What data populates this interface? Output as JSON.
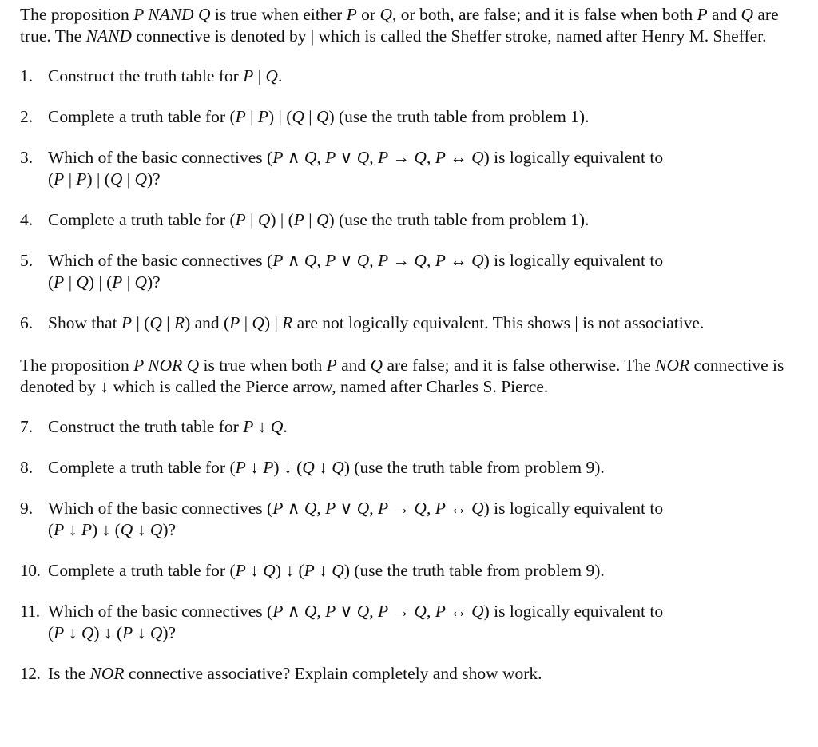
{
  "intro_nand": [
    {
      "t": "The proposition ",
      "i": false
    },
    {
      "t": "P NAND Q",
      "i": true
    },
    {
      "t": " is true when either ",
      "i": false
    },
    {
      "t": "P",
      "i": true
    },
    {
      "t": " or ",
      "i": false
    },
    {
      "t": "Q",
      "i": true
    },
    {
      "t": ", or both, are false; and it is false when both ",
      "i": false
    },
    {
      "t": "P",
      "i": true
    },
    {
      "t": " and ",
      "i": false
    },
    {
      "t": "Q",
      "i": true
    },
    {
      "t": " are true. The ",
      "i": false
    },
    {
      "t": "NAND",
      "i": true
    },
    {
      "t": " connective is denoted by | which is called the Sheffer stroke, named after Henry M. Sheffer.",
      "i": false
    }
  ],
  "problems_nand": [
    {
      "num": "1.",
      "parts": [
        {
          "t": "Construct the truth table for ",
          "i": false
        },
        {
          "t": "P",
          "i": true
        },
        {
          "t": " | ",
          "i": false
        },
        {
          "t": "Q",
          "i": true
        },
        {
          "t": ".",
          "i": false
        }
      ]
    },
    {
      "num": "2.",
      "parts": [
        {
          "t": "Complete a truth table for (",
          "i": false
        },
        {
          "t": "P",
          "i": true
        },
        {
          "t": " | ",
          "i": false
        },
        {
          "t": "P",
          "i": true
        },
        {
          "t": ") | (",
          "i": false
        },
        {
          "t": "Q",
          "i": true
        },
        {
          "t": " | ",
          "i": false
        },
        {
          "t": "Q",
          "i": true
        },
        {
          "t": ") (use the truth table from problem 1).",
          "i": false
        }
      ]
    },
    {
      "num": "3.",
      "parts": [
        {
          "t": "Which of the basic connectives (",
          "i": false
        },
        {
          "t": "P",
          "i": true
        },
        {
          "t": " ∧ ",
          "i": false
        },
        {
          "t": "Q",
          "i": true
        },
        {
          "t": ", ",
          "i": false
        },
        {
          "t": "P",
          "i": true
        },
        {
          "t": " ∨ ",
          "i": false
        },
        {
          "t": "Q",
          "i": true
        },
        {
          "t": ", ",
          "i": false
        },
        {
          "t": "P",
          "i": true
        },
        {
          "t": " → ",
          "i": false
        },
        {
          "t": "Q",
          "i": true
        },
        {
          "t": ", ",
          "i": false
        },
        {
          "t": "P",
          "i": true
        },
        {
          "t": " ↔ ",
          "i": false
        },
        {
          "t": "Q",
          "i": true
        },
        {
          "t": ") is logically equivalent to ",
          "i": false
        },
        {
          "t": "\n(",
          "i": false
        },
        {
          "t": "P",
          "i": true
        },
        {
          "t": " | ",
          "i": false
        },
        {
          "t": "P",
          "i": true
        },
        {
          "t": ") | (",
          "i": false
        },
        {
          "t": "Q",
          "i": true
        },
        {
          "t": " | ",
          "i": false
        },
        {
          "t": "Q",
          "i": true
        },
        {
          "t": ")?",
          "i": false
        }
      ]
    },
    {
      "num": "4.",
      "parts": [
        {
          "t": "Complete a truth table for (",
          "i": false
        },
        {
          "t": "P",
          "i": true
        },
        {
          "t": " | ",
          "i": false
        },
        {
          "t": "Q",
          "i": true
        },
        {
          "t": ") | (",
          "i": false
        },
        {
          "t": "P",
          "i": true
        },
        {
          "t": " | ",
          "i": false
        },
        {
          "t": "Q",
          "i": true
        },
        {
          "t": ") (use the truth table from problem 1).",
          "i": false
        }
      ]
    },
    {
      "num": "5.",
      "parts": [
        {
          "t": "Which of the basic connectives (",
          "i": false
        },
        {
          "t": "P",
          "i": true
        },
        {
          "t": " ∧ ",
          "i": false
        },
        {
          "t": "Q",
          "i": true
        },
        {
          "t": ", ",
          "i": false
        },
        {
          "t": "P",
          "i": true
        },
        {
          "t": " ∨ ",
          "i": false
        },
        {
          "t": "Q",
          "i": true
        },
        {
          "t": ", ",
          "i": false
        },
        {
          "t": "P",
          "i": true
        },
        {
          "t": " → ",
          "i": false
        },
        {
          "t": "Q",
          "i": true
        },
        {
          "t": ", ",
          "i": false
        },
        {
          "t": "P",
          "i": true
        },
        {
          "t": " ↔ ",
          "i": false
        },
        {
          "t": "Q",
          "i": true
        },
        {
          "t": ") is logically equivalent to ",
          "i": false
        },
        {
          "t": "\n(",
          "i": false
        },
        {
          "t": "P",
          "i": true
        },
        {
          "t": " | ",
          "i": false
        },
        {
          "t": "Q",
          "i": true
        },
        {
          "t": ") | (",
          "i": false
        },
        {
          "t": "P",
          "i": true
        },
        {
          "t": " | ",
          "i": false
        },
        {
          "t": "Q",
          "i": true
        },
        {
          "t": ")?",
          "i": false
        }
      ]
    },
    {
      "num": "6.",
      "parts": [
        {
          "t": "Show that ",
          "i": false
        },
        {
          "t": "P",
          "i": true
        },
        {
          "t": " | (",
          "i": false
        },
        {
          "t": "Q",
          "i": true
        },
        {
          "t": " | ",
          "i": false
        },
        {
          "t": "R",
          "i": true
        },
        {
          "t": ") and (",
          "i": false
        },
        {
          "t": "P",
          "i": true
        },
        {
          "t": " | ",
          "i": false
        },
        {
          "t": "Q",
          "i": true
        },
        {
          "t": ") | ",
          "i": false
        },
        {
          "t": "R",
          "i": true
        },
        {
          "t": " are not logically equivalent. This shows | is not associative.",
          "i": false
        }
      ]
    }
  ],
  "intro_nor": [
    {
      "t": "The proposition ",
      "i": false
    },
    {
      "t": "P NOR Q",
      "i": true
    },
    {
      "t": " is true when both ",
      "i": false
    },
    {
      "t": "P",
      "i": true
    },
    {
      "t": " and ",
      "i": false
    },
    {
      "t": "Q",
      "i": true
    },
    {
      "t": " are false; and it is false otherwise. The ",
      "i": false
    },
    {
      "t": "NOR",
      "i": true
    },
    {
      "t": " connective is denoted by ↓ which is called the Pierce arrow, named after Charles S. Pierce.",
      "i": false
    }
  ],
  "problems_nor": [
    {
      "num": "7.",
      "parts": [
        {
          "t": "Construct the truth table for ",
          "i": false
        },
        {
          "t": "P",
          "i": true
        },
        {
          "t": " ↓ ",
          "i": false
        },
        {
          "t": "Q",
          "i": true
        },
        {
          "t": ".",
          "i": false
        }
      ]
    },
    {
      "num": "8.",
      "parts": [
        {
          "t": "Complete a truth table for (",
          "i": false
        },
        {
          "t": "P",
          "i": true
        },
        {
          "t": " ↓ ",
          "i": false
        },
        {
          "t": "P",
          "i": true
        },
        {
          "t": ") ↓ (",
          "i": false
        },
        {
          "t": "Q",
          "i": true
        },
        {
          "t": " ↓ ",
          "i": false
        },
        {
          "t": "Q",
          "i": true
        },
        {
          "t": ") (use the truth table from problem 9).",
          "i": false
        }
      ]
    },
    {
      "num": "9.",
      "parts": [
        {
          "t": "Which of the basic connectives (",
          "i": false
        },
        {
          "t": "P",
          "i": true
        },
        {
          "t": " ∧ ",
          "i": false
        },
        {
          "t": "Q",
          "i": true
        },
        {
          "t": ", ",
          "i": false
        },
        {
          "t": "P",
          "i": true
        },
        {
          "t": " ∨ ",
          "i": false
        },
        {
          "t": "Q",
          "i": true
        },
        {
          "t": ", ",
          "i": false
        },
        {
          "t": "P",
          "i": true
        },
        {
          "t": " → ",
          "i": false
        },
        {
          "t": "Q",
          "i": true
        },
        {
          "t": ", ",
          "i": false
        },
        {
          "t": "P",
          "i": true
        },
        {
          "t": " ↔ ",
          "i": false
        },
        {
          "t": "Q",
          "i": true
        },
        {
          "t": ") is logically equivalent to ",
          "i": false
        },
        {
          "t": "\n(",
          "i": false
        },
        {
          "t": "P",
          "i": true
        },
        {
          "t": " ↓ ",
          "i": false
        },
        {
          "t": "P",
          "i": true
        },
        {
          "t": ") ↓ (",
          "i": false
        },
        {
          "t": "Q",
          "i": true
        },
        {
          "t": " ↓ ",
          "i": false
        },
        {
          "t": "Q",
          "i": true
        },
        {
          "t": ")?",
          "i": false
        }
      ]
    },
    {
      "num": "10.",
      "parts": [
        {
          "t": "Complete a truth table for (",
          "i": false
        },
        {
          "t": "P",
          "i": true
        },
        {
          "t": " ↓ ",
          "i": false
        },
        {
          "t": "Q",
          "i": true
        },
        {
          "t": ") ↓ (",
          "i": false
        },
        {
          "t": "P",
          "i": true
        },
        {
          "t": " ↓ ",
          "i": false
        },
        {
          "t": "Q",
          "i": true
        },
        {
          "t": ") (use the truth table from problem 9).",
          "i": false
        }
      ]
    },
    {
      "num": "11.",
      "parts": [
        {
          "t": "Which of the basic connectives (",
          "i": false
        },
        {
          "t": "P",
          "i": true
        },
        {
          "t": " ∧ ",
          "i": false
        },
        {
          "t": "Q",
          "i": true
        },
        {
          "t": ", ",
          "i": false
        },
        {
          "t": "P",
          "i": true
        },
        {
          "t": " ∨ ",
          "i": false
        },
        {
          "t": "Q",
          "i": true
        },
        {
          "t": ", ",
          "i": false
        },
        {
          "t": "P",
          "i": true
        },
        {
          "t": " → ",
          "i": false
        },
        {
          "t": "Q",
          "i": true
        },
        {
          "t": ", ",
          "i": false
        },
        {
          "t": "P",
          "i": true
        },
        {
          "t": " ↔ ",
          "i": false
        },
        {
          "t": "Q",
          "i": true
        },
        {
          "t": ") is logically equivalent to ",
          "i": false
        },
        {
          "t": "\n(",
          "i": false
        },
        {
          "t": "P",
          "i": true
        },
        {
          "t": " ↓ ",
          "i": false
        },
        {
          "t": "Q",
          "i": true
        },
        {
          "t": ") ↓ (",
          "i": false
        },
        {
          "t": "P",
          "i": true
        },
        {
          "t": " ↓ ",
          "i": false
        },
        {
          "t": "Q",
          "i": true
        },
        {
          "t": ")?",
          "i": false
        }
      ]
    },
    {
      "num": "12.",
      "parts": [
        {
          "t": "Is the ",
          "i": false
        },
        {
          "t": "NOR",
          "i": true
        },
        {
          "t": " connective associative? Explain completely and show work.",
          "i": false
        }
      ]
    }
  ]
}
